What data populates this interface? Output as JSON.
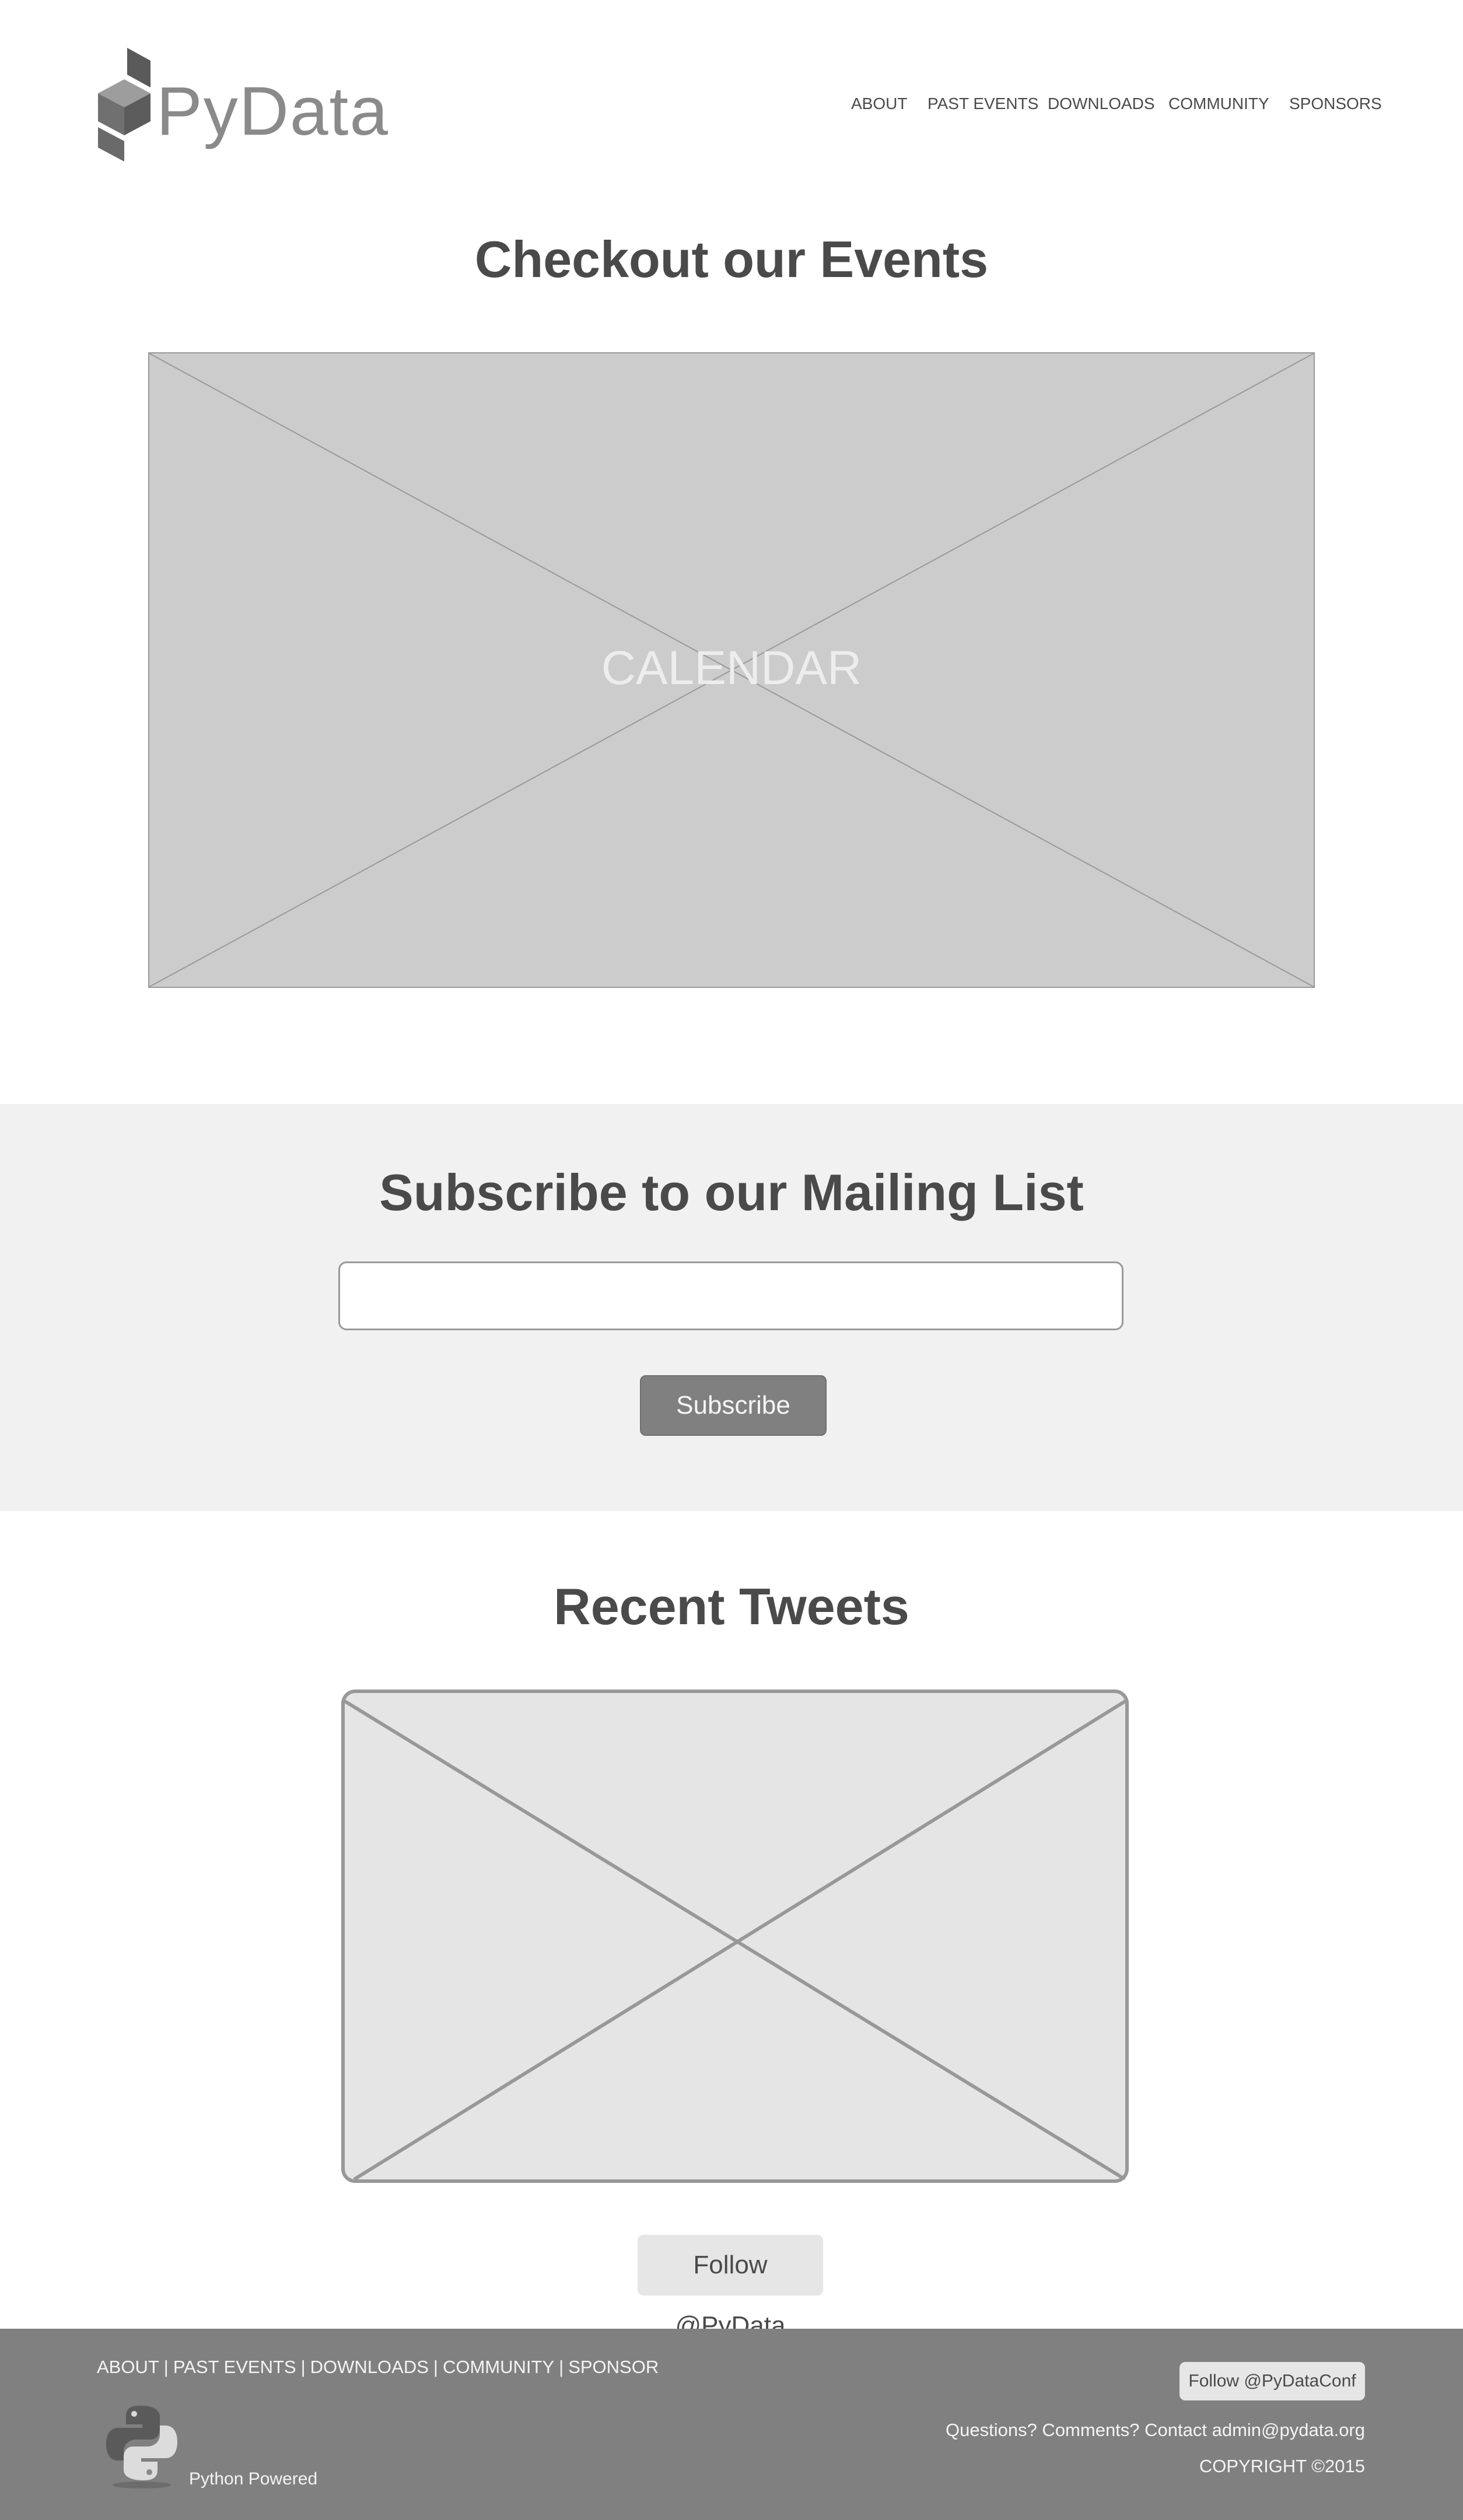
{
  "header": {
    "logo_text": "PyData",
    "nav": [
      "ABOUT",
      "PAST EVENTS",
      "DOWNLOADS",
      "COMMUNITY",
      "SPONSORS"
    ]
  },
  "events": {
    "title": "Checkout our Events",
    "calendar_label": "CALENDAR"
  },
  "subscribe": {
    "title": "Subscribe to our Mailing List",
    "email_value": "",
    "button_label": "Subscribe"
  },
  "tweets": {
    "title": "Recent Tweets",
    "follow_label": "Follow @PyData"
  },
  "footer": {
    "links": [
      "ABOUT",
      "PAST EVENTS",
      "DOWNLOADS",
      "COMMUNITY",
      "SPONSOR"
    ],
    "separator": "|",
    "python_powered": "Python Powered",
    "follow_label": "Follow @PyDataConf",
    "contact": "Questions? Comments? Contact admin@pydata.org",
    "copyright": "COPYRIGHT ©2015"
  },
  "colors": {
    "page_bg": "#ffffff",
    "band_bg": "#f1f1f1",
    "footer_bg": "#808080",
    "placeholder_bg": "#cccccc",
    "button_bg": "#808080",
    "text": "#4a4a4a"
  },
  "icons": [
    "pydata-cube-icon",
    "python-logo-icon"
  ]
}
